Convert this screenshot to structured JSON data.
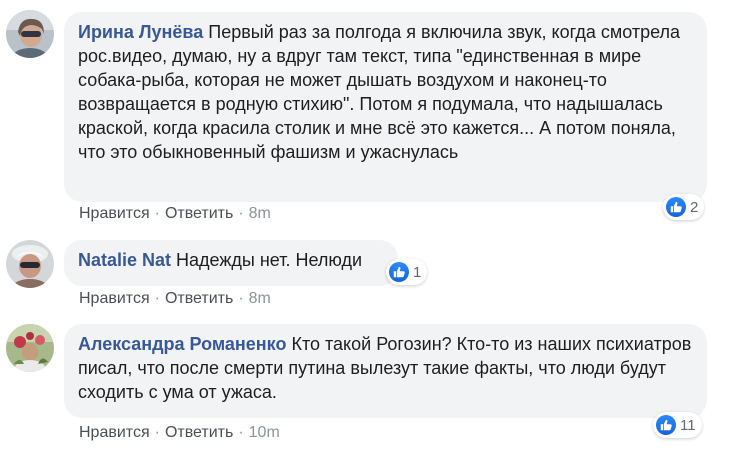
{
  "comments": [
    {
      "author": "Ирина Лунёва",
      "text": "Первый раз за полгода я включила звук, когда смотрела рос.видео, думаю, ну а вдруг там текст, типа \"единственная в мире собака-рыба, которая не может дышать воздухом и наконец-то возвращается в родную стихию\". Потом я подумала, что надышалась краской, когда красила столик и мне всё это кажется... А потом поняла, что это обыкновенный фашизм и ужаснулась",
      "like_label": "Нравится",
      "reply_label": "Ответить",
      "time": "8m",
      "reaction_count": "2"
    },
    {
      "author": "Natalie Nat",
      "text": "Надежды нет. Нелюди",
      "like_label": "Нравится",
      "reply_label": "Ответить",
      "time": "8m",
      "reaction_count": "1"
    },
    {
      "author": "Александра Романенко",
      "text": "Кто такой Рогозин? Кто-то из наших психиатров писал, что после смерти путина вылезут такие факты, что люди будут сходить с ума от ужаса.",
      "like_label": "Нравится",
      "reply_label": "Ответить",
      "time": "10m",
      "reaction_count": "11"
    }
  ],
  "separator": "·",
  "colors": {
    "author": "#385898",
    "bubble": "#f2f3f5",
    "like_blue": "#1877f2",
    "meta": "#606770"
  },
  "icons": {
    "reaction": "thumbs-up-icon"
  }
}
